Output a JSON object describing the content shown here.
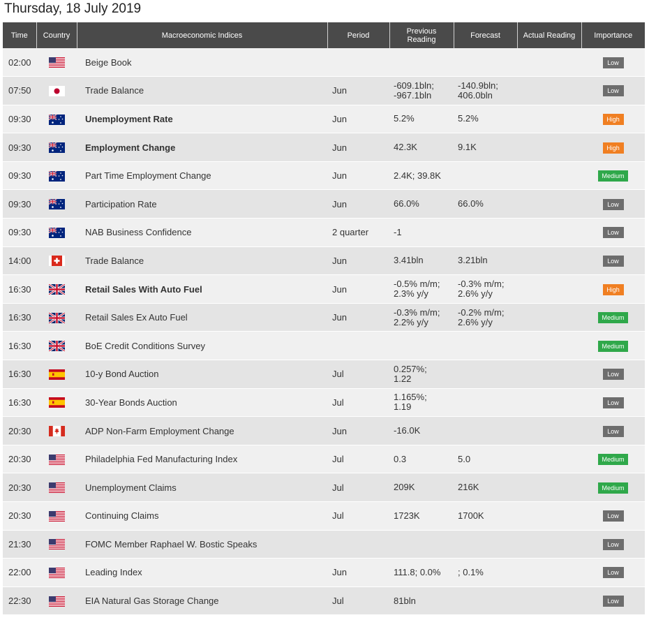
{
  "page": {
    "date": "Thursday, 18 July 2019"
  },
  "columns": {
    "time": "Time",
    "country": "Country",
    "index": "Macroeconomic Indices",
    "period": "Period",
    "previous_1": "Previous",
    "previous_2": "Reading",
    "forecast": "Forecast",
    "actual": "Actual Reading",
    "importance": "Importance"
  },
  "rows": [
    {
      "time": "02:00",
      "flag": "us",
      "event": "Beige Book",
      "bold": false,
      "period": "",
      "prev": "",
      "fcst": "",
      "actual": "",
      "importance": "Low",
      "level": "low"
    },
    {
      "time": "07:50",
      "flag": "jp",
      "event": "Trade Balance",
      "bold": false,
      "period": "Jun",
      "prev": "-609.1bln;\n-967.1bln",
      "fcst": "-140.9bln;\n406.0bln",
      "actual": "",
      "importance": "Low",
      "level": "low"
    },
    {
      "time": "09:30",
      "flag": "au",
      "event": "Unemployment Rate",
      "bold": true,
      "period": "Jun",
      "prev": "5.2%",
      "fcst": "5.2%",
      "actual": "",
      "importance": "High",
      "level": "high"
    },
    {
      "time": "09:30",
      "flag": "au",
      "event": "Employment Change",
      "bold": true,
      "period": "Jun",
      "prev": "42.3K",
      "fcst": "9.1K",
      "actual": "",
      "importance": "High",
      "level": "high"
    },
    {
      "time": "09:30",
      "flag": "au",
      "event": "Part Time Employment Change",
      "bold": false,
      "period": "Jun",
      "prev": "2.4K; 39.8K",
      "fcst": "",
      "actual": "",
      "importance": "Medium",
      "level": "medium"
    },
    {
      "time": "09:30",
      "flag": "au",
      "event": "Participation Rate",
      "bold": false,
      "period": "Jun",
      "prev": "66.0%",
      "fcst": "66.0%",
      "actual": "",
      "importance": "Low",
      "level": "low"
    },
    {
      "time": "09:30",
      "flag": "au",
      "event": "NAB Business Confidence",
      "bold": false,
      "period": "2 quarter",
      "prev": "-1",
      "fcst": "",
      "actual": "",
      "importance": "Low",
      "level": "low"
    },
    {
      "time": "14:00",
      "flag": "ch",
      "event": "Trade Balance",
      "bold": false,
      "period": "Jun",
      "prev": "3.41bln",
      "fcst": "3.21bln",
      "actual": "",
      "importance": "Low",
      "level": "low"
    },
    {
      "time": "16:30",
      "flag": "gb",
      "event": "Retail Sales With Auto Fuel",
      "bold": true,
      "period": "Jun",
      "prev": "-0.5% m/m;\n2.3% y/y",
      "fcst": "-0.3% m/m;\n2.6% y/y",
      "actual": "",
      "importance": "High",
      "level": "high"
    },
    {
      "time": "16:30",
      "flag": "gb",
      "event": "Retail Sales Ex Auto Fuel",
      "bold": false,
      "period": "Jun",
      "prev": "-0.3% m/m;\n2.2% y/y",
      "fcst": "-0.2% m/m;\n2.6% y/y",
      "actual": "",
      "importance": "Medium",
      "level": "medium"
    },
    {
      "time": "16:30",
      "flag": "gb",
      "event": "BoE Credit Conditions Survey",
      "bold": false,
      "period": "",
      "prev": "",
      "fcst": "",
      "actual": "",
      "importance": "Medium",
      "level": "medium"
    },
    {
      "time": "16:30",
      "flag": "es",
      "event": "10-y Bond Auction",
      "bold": false,
      "period": "Jul",
      "prev": "0.257%;\n1.22",
      "fcst": "",
      "actual": "",
      "importance": "Low",
      "level": "low"
    },
    {
      "time": "16:30",
      "flag": "es",
      "event": "30-Year Bonds Auction",
      "bold": false,
      "period": "Jul",
      "prev": "1.165%;\n1.19",
      "fcst": "",
      "actual": "",
      "importance": "Low",
      "level": "low"
    },
    {
      "time": "20:30",
      "flag": "ca",
      "event": "ADP Non-Farm Employment Change",
      "bold": false,
      "period": "Jun",
      "prev": "-16.0K",
      "fcst": "",
      "actual": "",
      "importance": "Low",
      "level": "low"
    },
    {
      "time": "20:30",
      "flag": "us",
      "event": "Philadelphia Fed Manufacturing Index",
      "bold": false,
      "period": "Jul",
      "prev": "0.3",
      "fcst": "5.0",
      "actual": "",
      "importance": "Medium",
      "level": "medium"
    },
    {
      "time": "20:30",
      "flag": "us",
      "event": "Unemployment Claims",
      "bold": false,
      "period": "Jul",
      "prev": "209K",
      "fcst": "216K",
      "actual": "",
      "importance": "Medium",
      "level": "medium"
    },
    {
      "time": "20:30",
      "flag": "us",
      "event": "Continuing Claims",
      "bold": false,
      "period": "Jul",
      "prev": "1723K",
      "fcst": "1700K",
      "actual": "",
      "importance": "Low",
      "level": "low"
    },
    {
      "time": "21:30",
      "flag": "us",
      "event": "FOMC Member Raphael W. Bostic Speaks",
      "bold": false,
      "period": "",
      "prev": "",
      "fcst": "",
      "actual": "",
      "importance": "Low",
      "level": "low"
    },
    {
      "time": "22:00",
      "flag": "us",
      "event": "Leading Index",
      "bold": false,
      "period": "Jun",
      "prev": "111.8; 0.0%",
      "fcst": "; 0.1%",
      "actual": "",
      "importance": "Low",
      "level": "low"
    },
    {
      "time": "22:30",
      "flag": "us",
      "event": "EIA Natural Gas Storage Change",
      "bold": false,
      "period": "Jul",
      "prev": "81bln",
      "fcst": "",
      "actual": "",
      "importance": "Low",
      "level": "low"
    }
  ]
}
